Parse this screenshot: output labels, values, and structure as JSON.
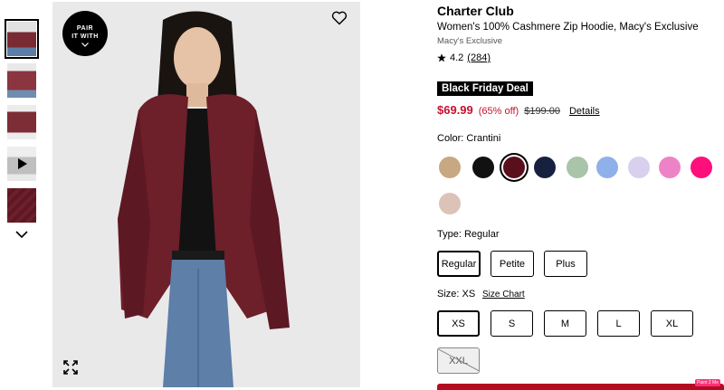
{
  "gallery": {
    "pair_badge_line1": "PAIR",
    "pair_badge_line2": "IT WITH",
    "thumbnails": [
      {
        "name": "thumb-front",
        "color": "#7a2a33"
      },
      {
        "name": "thumb-back",
        "color": "#8a3540"
      },
      {
        "name": "thumb-side",
        "color": "#7d2d36"
      },
      {
        "name": "thumb-video",
        "color": "#d9d9d9"
      },
      {
        "name": "thumb-fabric",
        "color": "#6e1f2b"
      }
    ],
    "icons": {
      "heart": "heart-icon",
      "expand": "expand-icon",
      "play": "play-icon",
      "thumbs_down": "chevron-down-icon"
    }
  },
  "product": {
    "brand": "Charter Club",
    "name": "Women's 100% Cashmere Zip Hoodie, Macy's Exclusive",
    "exclusive": "Macy's Exclusive",
    "rating": "4.2",
    "review_count": "(284)",
    "deal_badge": "Black Friday Deal",
    "sale_price": "$69.99",
    "discount": "(65% off)",
    "original_price": "$199.00",
    "details_link": "Details"
  },
  "color": {
    "label": "Color: Crantini",
    "swatches": [
      {
        "name": "Camel",
        "hex": "#c8a783"
      },
      {
        "name": "Black",
        "hex": "#111111"
      },
      {
        "name": "Crantini",
        "hex": "#5a0f1c",
        "selected": true
      },
      {
        "name": "Navy",
        "hex": "#17203f"
      },
      {
        "name": "Sage",
        "hex": "#a9c4a9"
      },
      {
        "name": "Blue",
        "hex": "#8fb0e8"
      },
      {
        "name": "Lavender",
        "hex": "#d8d0ec"
      },
      {
        "name": "Pink",
        "hex": "#ee82c6"
      },
      {
        "name": "Fuchsia",
        "hex": "#ff0f7c"
      },
      {
        "name": "Oatmeal",
        "hex": "#dcc3b8"
      }
    ]
  },
  "type": {
    "label": "Type: Regular",
    "options": [
      "Regular",
      "Petite",
      "Plus"
    ],
    "selected": "Regular"
  },
  "size": {
    "label": "Size: XS",
    "chart_link": "Size Chart",
    "options": [
      "XS",
      "S",
      "M",
      "L",
      "XL",
      "XXL"
    ],
    "selected": "XS",
    "unavailable": [
      "XXL"
    ]
  },
  "overlay_tag": "Paint 2 Me",
  "colors": {
    "sale_red": "#c8102e",
    "add_to_bag": "#b30c21"
  }
}
